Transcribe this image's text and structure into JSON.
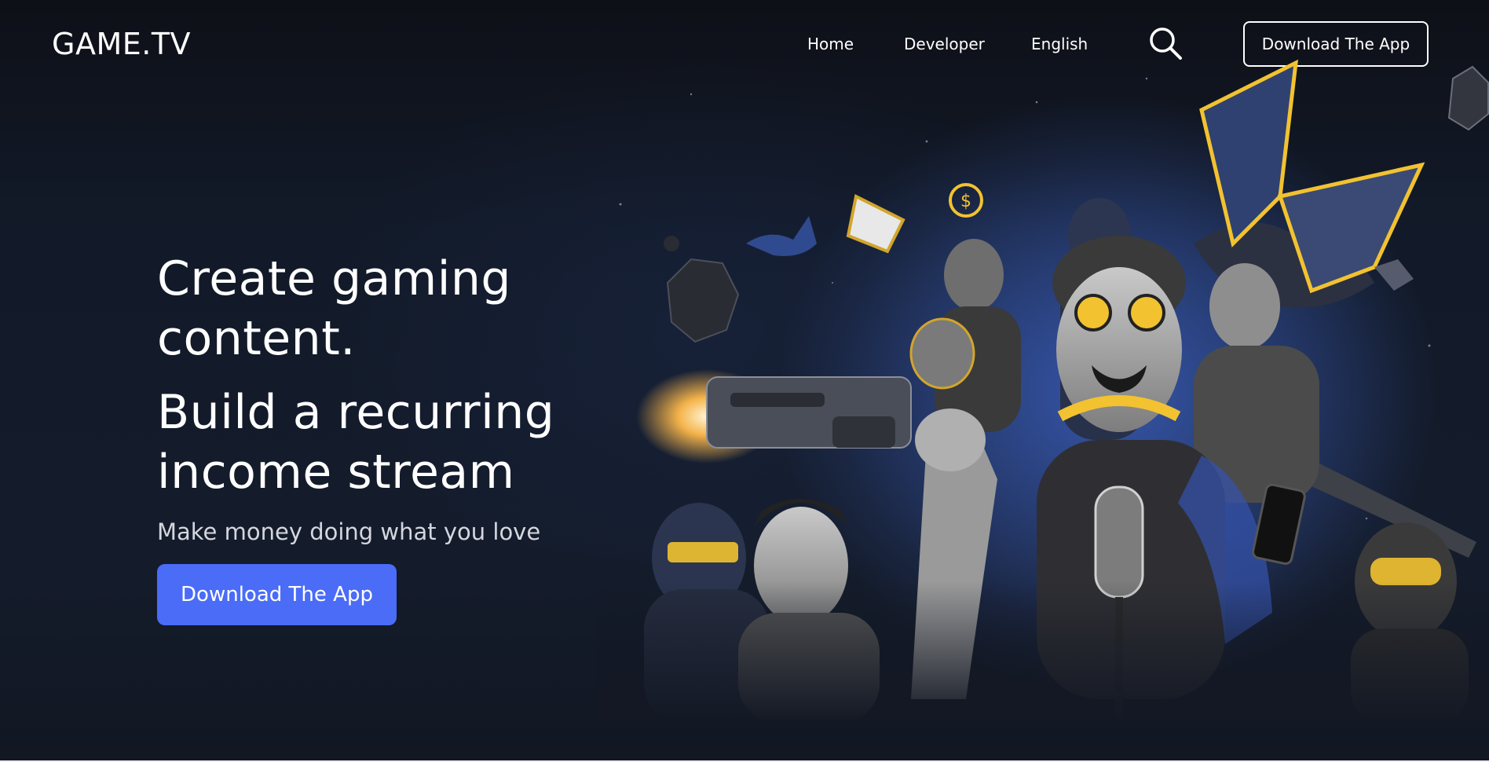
{
  "header": {
    "logo": "GAME.TV",
    "nav": [
      "Home",
      "Developer",
      "English"
    ],
    "search_icon": "search-icon",
    "download_label": "Download The App"
  },
  "hero": {
    "headline_1": [
      "Create gaming",
      "content."
    ],
    "headline_2": [
      "Build a recurring",
      "income stream"
    ],
    "subtitle": "Make money doing what you love",
    "cta_label": "Download The App",
    "artwork": "gamers-collage-illustration"
  },
  "colors": {
    "background": "#131a28",
    "accent": "#4a6cf7",
    "highlight": "#f2c230"
  }
}
